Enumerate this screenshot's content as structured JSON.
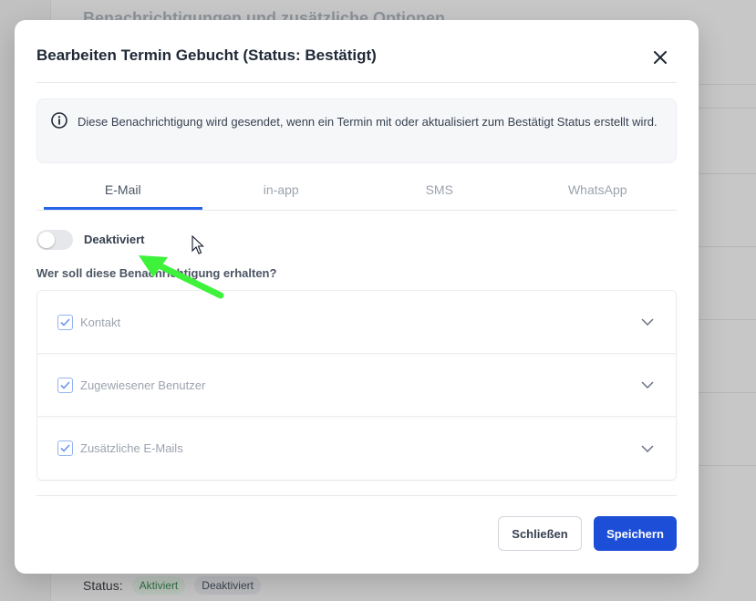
{
  "background": {
    "heading": "Benachrichtigungen und zusätzliche Optionen",
    "status_label": "Status:",
    "status_active": "Aktiviert",
    "status_inactive": "Deaktiviert"
  },
  "modal": {
    "title": "Bearbeiten Termin Gebucht (Status: Bestätigt)",
    "close_icon": "close-icon",
    "info": {
      "icon": "info-icon",
      "text": "Diese Benachrichtigung wird gesendet, wenn ein Termin mit oder aktualisiert zum Bestätigt Status erstellt wird."
    },
    "tabs": [
      {
        "label": "E-Mail",
        "active": true
      },
      {
        "label": "in-app",
        "active": false
      },
      {
        "label": "SMS",
        "active": false
      },
      {
        "label": "WhatsApp",
        "active": false
      }
    ],
    "toggle": {
      "label": "Deaktiviert",
      "enabled": false
    },
    "question": "Wer soll diese Benachrichtigung erhalten?",
    "recipients": [
      {
        "label": "Kontakt",
        "checked": true
      },
      {
        "label": "Zugewiesener Benutzer",
        "checked": true
      },
      {
        "label": "Zusätzliche E-Mails",
        "checked": true
      }
    ],
    "buttons": {
      "close": "Schließen",
      "save": "Speichern"
    }
  },
  "colors": {
    "accent": "#1d4ed8",
    "tab_indicator": "#2563eb",
    "annotation_arrow": "#3ef23b"
  }
}
